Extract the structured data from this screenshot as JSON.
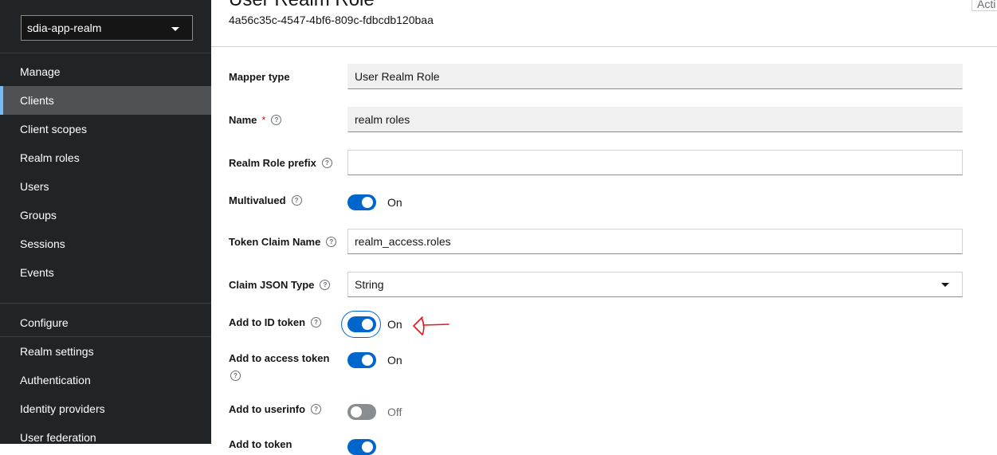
{
  "sidebar": {
    "realm_selector": "sdia-app-realm",
    "manage_heading": "Manage",
    "manage_items": [
      "Clients",
      "Client scopes",
      "Realm roles",
      "Users",
      "Groups",
      "Sessions",
      "Events"
    ],
    "active_item": "Clients",
    "configure_heading": "Configure",
    "configure_items": [
      "Realm settings",
      "Authentication",
      "Identity providers",
      "User federation"
    ]
  },
  "header": {
    "title": "User Realm Role",
    "subtitle": "4a56c35c-4547-4bf6-809c-fdbcdb120baa",
    "action_label": "Acti"
  },
  "form": {
    "mapper_type": {
      "label": "Mapper type",
      "value": "User Realm Role"
    },
    "name": {
      "label": "Name",
      "required_mark": "*",
      "value": "realm roles"
    },
    "realm_role_prefix": {
      "label": "Realm Role prefix",
      "value": ""
    },
    "multivalued": {
      "label": "Multivalued",
      "state": "On"
    },
    "token_claim_name": {
      "label": "Token Claim Name",
      "value": "realm_access.roles"
    },
    "claim_json_type": {
      "label": "Claim JSON Type",
      "value": "String"
    },
    "add_to_id_token": {
      "label": "Add to ID token",
      "state": "On"
    },
    "add_to_access_token": {
      "label": "Add to access token",
      "state": "On"
    },
    "add_to_userinfo": {
      "label": "Add to userinfo",
      "state": "Off"
    },
    "add_to_token_partial": {
      "label": "Add to token"
    }
  },
  "help_glyph": "?",
  "colors": {
    "sidebar_bg": "#212427",
    "active_item_bg": "#4f5255",
    "accent": "#0066cc",
    "annotation": "#e8141a"
  }
}
